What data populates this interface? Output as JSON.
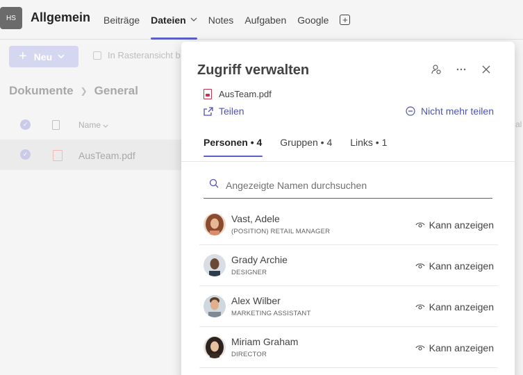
{
  "header": {
    "avatar_initials": "HS",
    "channel_title": "Allgemein",
    "tabs": [
      {
        "label": "Beiträge"
      },
      {
        "label": "Dateien",
        "active": true,
        "has_dropdown": true
      },
      {
        "label": "Notes"
      },
      {
        "label": "Aufgaben"
      },
      {
        "label": "Google"
      }
    ],
    "add_tab_icon": "plus-square-icon"
  },
  "files": {
    "new_button_label": "Neu",
    "grid_view_label": "In Rasteransicht b",
    "breadcrumb": [
      "Dokumente",
      "General"
    ],
    "column_name": "Name",
    "rows": [
      {
        "name": "AusTeam.pdf"
      }
    ],
    "right_edge_partial": "al"
  },
  "panel": {
    "title": "Zugriff verwalten",
    "file_name": "AusTeam.pdf",
    "share_label": "Teilen",
    "stop_sharing_label": "Nicht mehr teilen",
    "tabs": [
      {
        "label": "Personen • 4",
        "active": true
      },
      {
        "label": "Gruppen • 4"
      },
      {
        "label": "Links • 1"
      }
    ],
    "search_placeholder": "Angezeigte Namen durchsuchen",
    "people": [
      {
        "name": "Vast, Adele",
        "role": "(POSITION) RETAIL MANAGER",
        "permission": "Kann anzeigen"
      },
      {
        "name": "Grady Archie",
        "role": "DESIGNER",
        "permission": "Kann anzeigen"
      },
      {
        "name": "Alex Wilber",
        "role": "MARKETING ASSISTANT",
        "permission": "Kann anzeigen"
      },
      {
        "name": "Miriam Graham",
        "role": "DIRECTOR",
        "permission": "Kann anzeigen"
      }
    ]
  },
  "colors": {
    "accent": "#5b5fc7",
    "link": "#4f52b2",
    "pdf_red": "#c4314b"
  }
}
